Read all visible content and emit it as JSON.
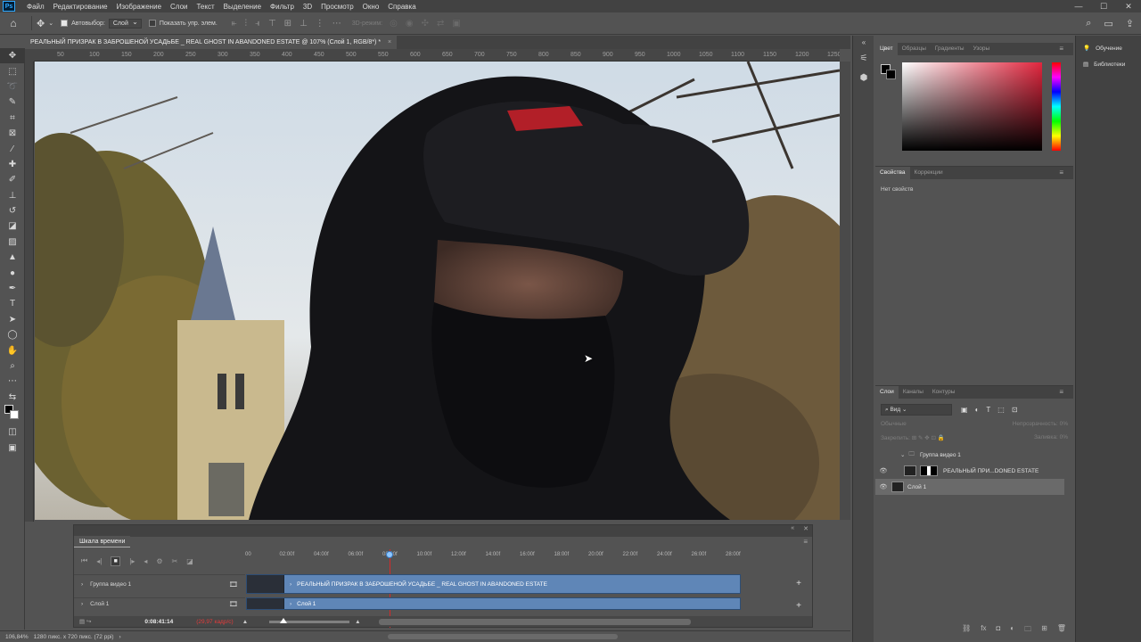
{
  "app": {
    "logo": "Ps"
  },
  "menu": [
    "Файл",
    "Редактирование",
    "Изображение",
    "Слои",
    "Текст",
    "Выделение",
    "Фильтр",
    "3D",
    "Просмотр",
    "Окно",
    "Справка"
  ],
  "window_controls": {
    "minimize": "—",
    "maximize": "☐",
    "close": "✕"
  },
  "options": {
    "autoselect_label": "Автовыбор:",
    "autoselect_target": "Слой",
    "show_transform_label": "Показать упр. элем.",
    "mode3d_label": "3D-режим:"
  },
  "document": {
    "tab_title": "РЕАЛЬНЫЙ ПРИЗРАК В ЗАБРОШЕНОЙ УСАДЬБЕ _ REAL GHOST IN ABANDONED ESTATE @ 107% (Слой 1, RGB/8*) *",
    "close": "×"
  },
  "ruler_ticks": [
    "50",
    "100",
    "150",
    "200",
    "250",
    "300",
    "350",
    "400",
    "450",
    "500",
    "550",
    "600",
    "650",
    "700",
    "750",
    "800",
    "850",
    "900",
    "950",
    "1000",
    "1050",
    "1100",
    "1150",
    "1200",
    "1250"
  ],
  "timeline": {
    "title": "Шкала времени",
    "ruler": [
      "00",
      "02:00f",
      "04:00f",
      "06:00f",
      "08:00f",
      "10:00f",
      "12:00f",
      "14:00f",
      "16:00f",
      "18:00f",
      "20:00f",
      "22:00f",
      "24:00f",
      "26:00f",
      "28:00f"
    ],
    "playhead_position": 0.29,
    "tracks": [
      {
        "label": "Группа видео 1",
        "clip": "РЕАЛЬНЫЙ ПРИЗРАК В ЗАБРОШЕНОЙ УСАДЬБЕ _ REAL GHOST IN ABANDONED ESTATE"
      },
      {
        "label": "Слой 1",
        "clip": "Слой 1"
      }
    ],
    "current_time": "0:08:41:14",
    "fps": "(29,97 кадр/с)"
  },
  "status": {
    "zoom": "106,84%",
    "info": "1280 пикс. x 720 пикс. (72 ppi)",
    "arrow": "›"
  },
  "color_panel": {
    "tabs": [
      "Цвет",
      "Образцы",
      "Градиенты",
      "Узоры"
    ],
    "active": "Цвет"
  },
  "properties_panel": {
    "tabs": [
      "Свойства",
      "Коррекции"
    ],
    "active": "Свойства",
    "empty_text": "Нет свойств"
  },
  "layers_panel": {
    "tabs": [
      "Слои",
      "Каналы",
      "Контуры"
    ],
    "active": "Слои",
    "filter_kind": "Вид",
    "blend_mode": "Обычные",
    "opacity_label": "Непрозрачность:",
    "opacity_value": "0%",
    "lock_label": "Закрепить:",
    "fill_label": "Заливка:",
    "fill_value": "0%",
    "layers": [
      {
        "name": "Группа видео 1",
        "type": "group"
      },
      {
        "name": "РЕАЛЬНЫЙ ПРИ...DONED ESTATE",
        "type": "video"
      },
      {
        "name": "Слой 1",
        "type": "layer",
        "selected": true
      }
    ]
  },
  "learn_strip": {
    "learn": "Обучение",
    "libraries": "Библиотеки"
  },
  "colors": {
    "accent": "#5f86b7",
    "playhead": "#d12b2b",
    "panel_bg": "#535353"
  }
}
